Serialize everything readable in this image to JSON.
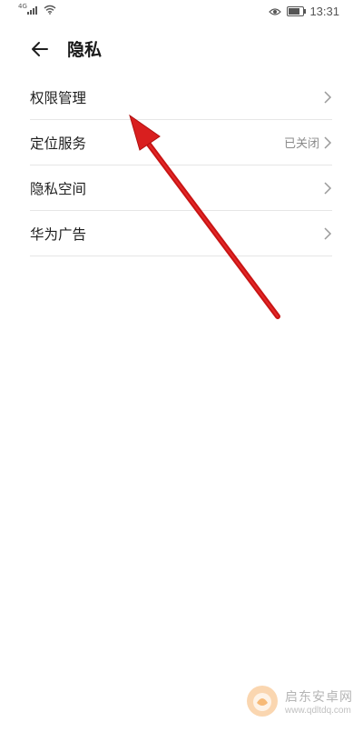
{
  "status_bar": {
    "network": "4G",
    "time": "13:31",
    "battery_level": 0.8,
    "icons": [
      "signal-icon",
      "wifi-icon",
      "eye-comfort-icon",
      "battery-icon"
    ]
  },
  "header": {
    "title": "隐私",
    "back_icon": "arrow-left-icon"
  },
  "list": {
    "items": [
      {
        "label": "权限管理",
        "value": "",
        "icon": "chevron-right-icon"
      },
      {
        "label": "定位服务",
        "value": "已关闭",
        "icon": "chevron-right-icon"
      },
      {
        "label": "隐私空间",
        "value": "",
        "icon": "chevron-right-icon"
      },
      {
        "label": "华为广告",
        "value": "",
        "icon": "chevron-right-icon"
      }
    ]
  },
  "annotation": {
    "type": "arrow",
    "color": "#d91f1f",
    "target": "权限管理"
  },
  "watermark": {
    "name": "启东安卓网",
    "url": "www.qdltdq.com",
    "accent": "#f08a1c"
  }
}
